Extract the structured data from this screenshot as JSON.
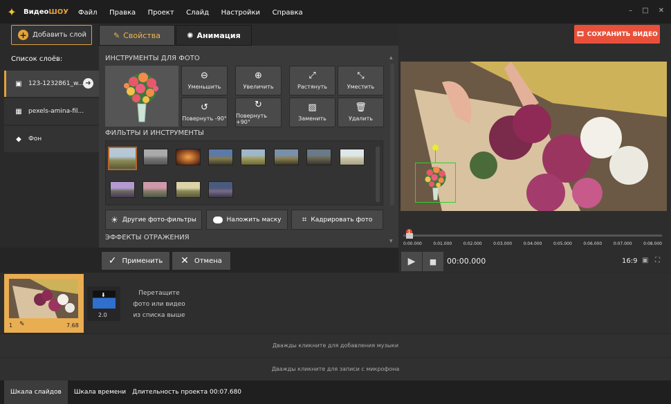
{
  "app": {
    "name_prefix": "Видео",
    "name_suffix": "ШОУ"
  },
  "menu": [
    "Файл",
    "Правка",
    "Проект",
    "Слайд",
    "Настройки",
    "Справка"
  ],
  "window": {
    "minimize": "–",
    "maximize": "□",
    "close": "✕"
  },
  "left": {
    "add_layer": "Добавить слой",
    "list_title": "Список слоёв:",
    "layers": [
      {
        "label": "123-1232861_w...",
        "icon": "image-icon"
      },
      {
        "label": "pexels-amina-fil...",
        "icon": "video-icon"
      },
      {
        "label": "Фон",
        "icon": "fill-icon"
      }
    ]
  },
  "tabs": {
    "properties": "Свойства",
    "animation": "Анимация"
  },
  "photo_tools": {
    "title": "ИНСТРУМЕНТЫ ДЛЯ ФОТО",
    "tools": [
      {
        "label": "Уменьшить",
        "icon": "zoom-out-icon"
      },
      {
        "label": "Увеличить",
        "icon": "zoom-in-icon"
      },
      {
        "label": "Растянуть",
        "icon": "stretch-icon"
      },
      {
        "label": "Уместить",
        "icon": "fit-icon"
      },
      {
        "label": "Повернуть -90°",
        "icon": "rotate-left-icon"
      },
      {
        "label": "Повернуть +90°",
        "icon": "rotate-right-icon"
      },
      {
        "label": "Заменить",
        "icon": "replace-icon"
      },
      {
        "label": "Удалить",
        "icon": "trash-icon"
      }
    ]
  },
  "filters": {
    "title": "ФИЛЬТРЫ И ИНСТРУМЕНТЫ",
    "other": "Другие фото-фильтры",
    "mask": "Наложить маску",
    "crop": "Кадрировать фото"
  },
  "reflection": {
    "title": "ЭФФЕКТЫ ОТРАЖЕНИЯ"
  },
  "actions": {
    "apply": "Применить",
    "cancel": "Отмена"
  },
  "save": {
    "label": "СОХРАНИТЬ ВИДЕО"
  },
  "timeline": {
    "ticks": [
      "0:00.000",
      "0:01.000",
      "0:02.000",
      "0:03.000",
      "0:04.000",
      "0:05.000",
      "0:06.000",
      "0:07.000",
      "0:08.000"
    ],
    "time": "00:00.000",
    "ratio": "16:9",
    "marker": "1"
  },
  "story": {
    "slide_number": "1",
    "slide_duration": "7.68",
    "transition_duration": "2.0",
    "drop_hint": "Перетащите фото или видео из списка выше"
  },
  "music_hint": "Дважды кликните для добавления музыки",
  "mic_hint": "Дважды кликните для записи с микрофона",
  "status": {
    "slides_tab": "Шкала слайдов",
    "timeline_tab": "Шкала времени",
    "duration": "Длительность проекта 00:07.680"
  },
  "colors": {
    "accent": "#e3a23b",
    "save": "#e8503a"
  }
}
